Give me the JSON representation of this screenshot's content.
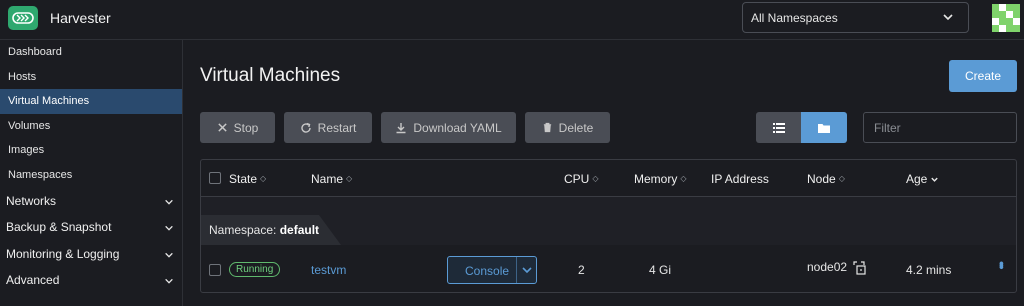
{
  "header": {
    "app_title": "Harvester",
    "namespace_select": "All Namespaces"
  },
  "sidebar": {
    "items": [
      {
        "label": "Dashboard"
      },
      {
        "label": "Hosts"
      },
      {
        "label": "Virtual Machines",
        "active": true
      },
      {
        "label": "Volumes"
      },
      {
        "label": "Images"
      },
      {
        "label": "Namespaces"
      }
    ],
    "groups": [
      {
        "label": "Networks"
      },
      {
        "label": "Backup & Snapshot"
      },
      {
        "label": "Monitoring & Logging"
      },
      {
        "label": "Advanced"
      }
    ]
  },
  "main": {
    "page_title": "Virtual Machines",
    "create_label": "Create",
    "toolbar": {
      "stop_label": "Stop",
      "restart_label": "Restart",
      "download_label": "Download YAML",
      "delete_label": "Delete"
    },
    "filter_placeholder": "Filter",
    "table": {
      "columns": {
        "state": "State",
        "name": "Name",
        "cpu": "CPU",
        "memory": "Memory",
        "ip": "IP Address",
        "node": "Node",
        "age": "Age"
      },
      "group_label": "Namespace:",
      "group_value": "default",
      "rows": [
        {
          "state": "Running",
          "name": "testvm",
          "console_label": "Console",
          "cpu": "2",
          "memory": "4 Gi",
          "ip": "",
          "node": "node02",
          "age": "4.2 mins"
        }
      ]
    }
  },
  "colors": {
    "background": "#1b1c21",
    "accent": "#5b9bd5",
    "active_nav": "#2a4a6e",
    "running": "#5fb86d",
    "logo": "#2fa86f"
  }
}
